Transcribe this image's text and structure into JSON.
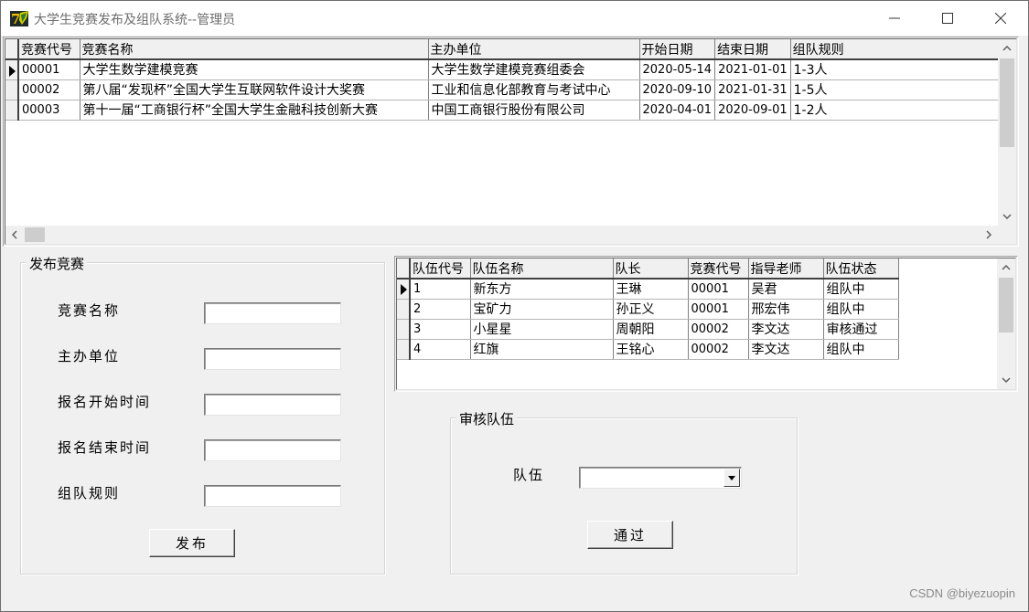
{
  "window": {
    "title": "大学生竞赛发布及组队系统--管理员"
  },
  "competitions_grid": {
    "columns": [
      "竞赛代号",
      "竞赛名称",
      "主办单位",
      "开始日期",
      "结束日期",
      "组队规则"
    ],
    "rows": [
      [
        "00001",
        "大学生数学建模竞赛",
        "大学生数学建模竞赛组委会",
        "2020-05-14",
        "2021-01-01",
        "1-3人"
      ],
      [
        "00002",
        "第八届“发现杯”全国大学生互联网软件设计大奖赛",
        "工业和信息化部教育与考试中心",
        "2020-09-10",
        "2021-01-31",
        "1-5人"
      ],
      [
        "00003",
        "第十一届“工商银行杯”全国大学生金融科技创新大赛",
        "中国工商银行股份有限公司",
        "2020-04-01",
        "2020-09-01",
        "1-2人"
      ]
    ],
    "selected_row": 0
  },
  "teams_grid": {
    "columns": [
      "队伍代号",
      "队伍名称",
      "队长",
      "竞赛代号",
      "指导老师",
      "队伍状态"
    ],
    "rows": [
      [
        "1",
        "新东方",
        "王琳",
        "00001",
        "吴君",
        "组队中"
      ],
      [
        "2",
        "宝矿力",
        "孙正义",
        "00001",
        "邢宏伟",
        "组队中"
      ],
      [
        "3",
        "小星星",
        "周朝阳",
        "00002",
        "李文达",
        "审核通过"
      ],
      [
        "4",
        "红旗",
        "王铭心",
        "00002",
        "李文达",
        "组队中"
      ]
    ],
    "selected_row": 0
  },
  "publish_group": {
    "title": "发布竞赛",
    "fields": [
      {
        "label": "竞赛名称",
        "value": ""
      },
      {
        "label": "主办单位",
        "value": ""
      },
      {
        "label": "报名开始时间",
        "value": ""
      },
      {
        "label": "报名结束时间",
        "value": ""
      },
      {
        "label": "组队规则",
        "value": ""
      }
    ],
    "submit_label": "发布"
  },
  "review_group": {
    "title": "审核队伍",
    "team_label": "队伍",
    "team_value": "",
    "approve_label": "通过"
  },
  "watermark": "CSDN @biyezuopin"
}
